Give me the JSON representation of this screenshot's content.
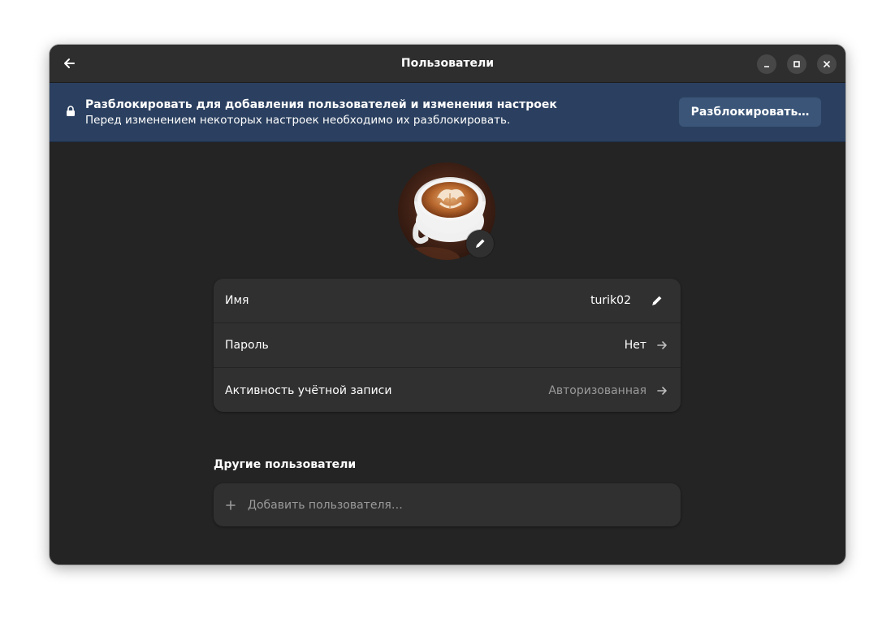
{
  "window": {
    "title": "Пользователи"
  },
  "banner": {
    "title": "Разблокировать для добавления пользователей и изменения настроек",
    "subtitle": "Перед изменением некоторых настроек необходимо их разблокировать.",
    "unlock_label": "Разблокировать…"
  },
  "account": {
    "rows": [
      {
        "label": "Имя",
        "value": "turik02",
        "icon": "pencil-icon"
      },
      {
        "label": "Пароль",
        "value": "Нет",
        "icon": "arrow-right-icon"
      },
      {
        "label": "Активность учётной записи",
        "value": "Авторизованная",
        "icon": "arrow-right-icon"
      }
    ]
  },
  "other_users": {
    "title": "Другие пользователи",
    "add_label": "Добавить пользователя…"
  },
  "colors": {
    "window_bg": "#242424",
    "headerbar_bg": "#2e2e2e",
    "banner_bg": "#2b4060",
    "card_bg": "#303030",
    "dim_text": "#9a9a9a"
  }
}
